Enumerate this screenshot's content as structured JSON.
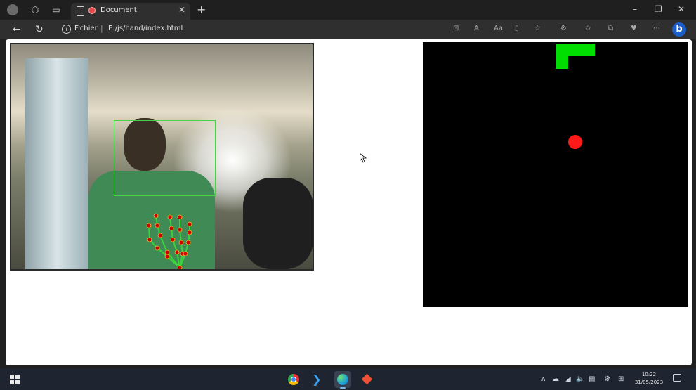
{
  "browser": {
    "tab_title": "Document",
    "tab_close": "✕",
    "new_tab": "+",
    "window_controls": {
      "minimize": "–",
      "restore": "❐",
      "close": "✕"
    },
    "address": {
      "scheme_label": "Fichier",
      "separator": "|",
      "url": "E:/js/hand/index.html"
    },
    "bing_label": "b"
  },
  "webcam": {
    "face_box_color": "#46d446",
    "landmark_color": "#cc0000",
    "connection_color": "#3cd23c"
  },
  "game": {
    "background": "#000000",
    "snake_color": "#00dd00",
    "food_color": "#ff1a1a"
  },
  "taskbar": {
    "apps": [
      "chrome-icon",
      "vscode-icon",
      "edge-icon",
      "git-icon"
    ],
    "clock_time": "10:22",
    "clock_date": "31/05/2023"
  }
}
